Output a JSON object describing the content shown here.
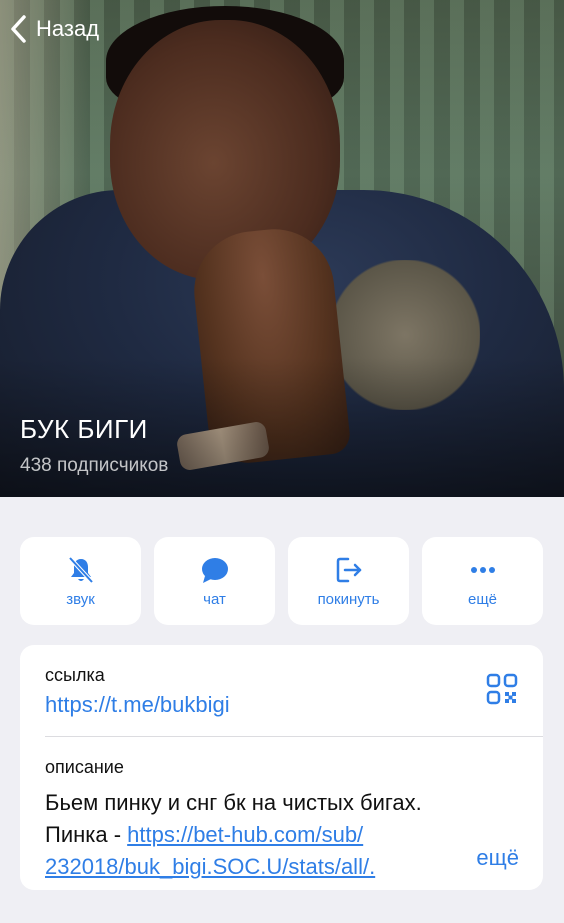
{
  "header": {
    "back_label": "Назад",
    "channel_name": "БУК БИГИ",
    "subscribers": "438 подписчиков"
  },
  "actions": [
    {
      "label": "звук",
      "icon": "bell-muted-icon"
    },
    {
      "label": "чат",
      "icon": "chat-bubble-icon"
    },
    {
      "label": "покинуть",
      "icon": "leave-icon"
    },
    {
      "label": "ещё",
      "icon": "more-dots-icon"
    }
  ],
  "info": {
    "link_label": "ссылка",
    "link_value": "https://t.me/bukbigi",
    "qr_icon": "qr-code-icon",
    "description_label": "описание",
    "description_line1": "Бьем пинку и снг бк на чистых бигах.",
    "description_prefix": "Пинка - ",
    "description_link_part1": "https://bet-hub.com/sub/",
    "description_link_part2": "232018/buk_bigi.SOC.U/stats/all/.",
    "more_label": "ещё"
  },
  "colors": {
    "accent": "#2f7ee6",
    "background": "#efeff4",
    "card": "#ffffff"
  }
}
